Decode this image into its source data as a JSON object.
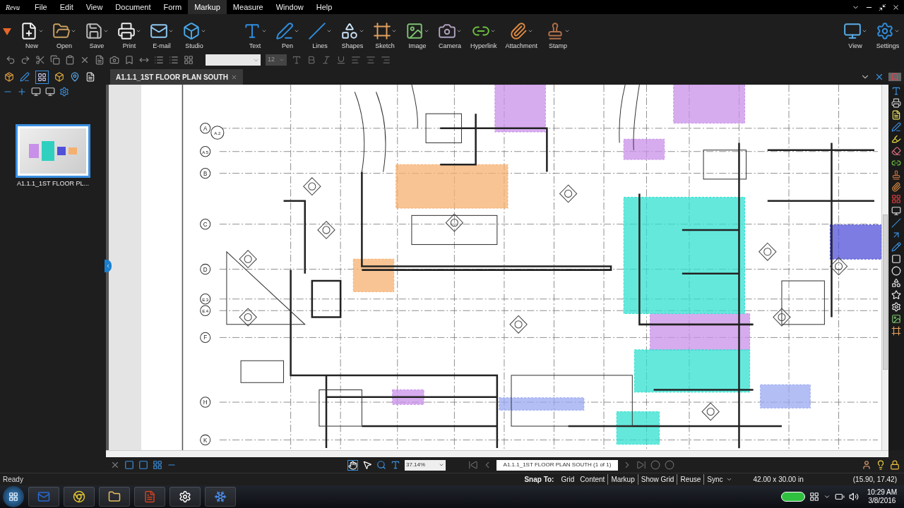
{
  "app": {
    "logo": "Revu"
  },
  "menu": [
    {
      "label": "File",
      "selected": false
    },
    {
      "label": "Edit",
      "selected": false
    },
    {
      "label": "View",
      "selected": false
    },
    {
      "label": "Document",
      "selected": false
    },
    {
      "label": "Form",
      "selected": false
    },
    {
      "label": "Markup",
      "selected": true
    },
    {
      "label": "Measure",
      "selected": false
    },
    {
      "label": "Window",
      "selected": false
    },
    {
      "label": "Help",
      "selected": false
    }
  ],
  "ribbon": {
    "left": [
      {
        "label": "New"
      },
      {
        "label": "Open"
      },
      {
        "label": "Save"
      },
      {
        "label": "Print"
      },
      {
        "label": "E-mail"
      },
      {
        "label": "Studio"
      }
    ],
    "markup": [
      {
        "label": "Text"
      },
      {
        "label": "Pen"
      },
      {
        "label": "Lines"
      },
      {
        "label": "Shapes"
      },
      {
        "label": "Sketch"
      },
      {
        "label": "Image"
      },
      {
        "label": "Camera"
      },
      {
        "label": "Hyperlink"
      },
      {
        "label": "Attachment"
      },
      {
        "label": "Stamp"
      }
    ],
    "right": [
      {
        "label": "View"
      },
      {
        "label": "Settings"
      }
    ]
  },
  "format_bar": {
    "font_size": "12"
  },
  "document_tab": {
    "title": "A1.1.1_1ST FLOOR PLAN SOUTH"
  },
  "thumbnails": [
    {
      "label": "A1.1.1_1ST FLOOR PL...",
      "selected": true
    }
  ],
  "grid_bubbles": [
    "A",
    "A.2",
    "A.5",
    "B",
    "C",
    "D",
    "E.3",
    "E.4",
    "F",
    "H",
    "K"
  ],
  "bottom_bar": {
    "zoom": "37.14%",
    "page": "A1.1.1_1ST FLOOR PLAN SOUTH (1 of 1)"
  },
  "status_bar": {
    "state": "Ready",
    "snap_label": "Snap To:",
    "snap_items": [
      {
        "label": "Grid"
      },
      {
        "label": "Content"
      },
      {
        "label": "Markup"
      },
      {
        "label": "Show Grid"
      },
      {
        "label": "Reuse"
      },
      {
        "label": "Sync"
      }
    ],
    "size": "42.00 x 30.00 in",
    "coords": "(15.90, 17.42)"
  },
  "taskbar": {
    "time": "10:29 AM",
    "date": "3/8/2016"
  }
}
